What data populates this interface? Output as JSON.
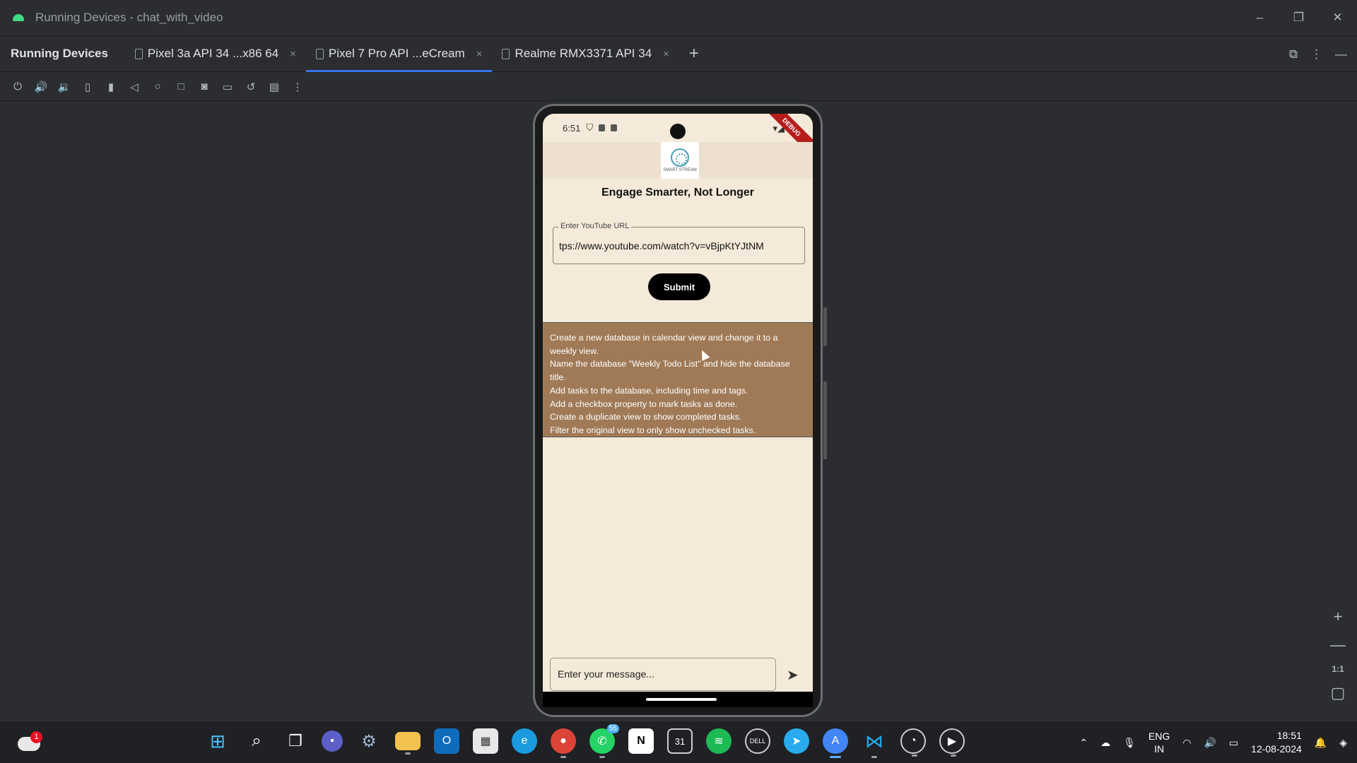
{
  "window": {
    "title": "Running Devices - chat_with_video",
    "minimize": "–",
    "restore": "❐",
    "close": "✕"
  },
  "tool_window": {
    "title": "Running Devices",
    "tabs": [
      {
        "label": "Pixel 3a API 34 ...x86 64",
        "close": "×"
      },
      {
        "label": "Pixel 7 Pro API ...eCream",
        "close": "×",
        "active": true
      },
      {
        "label": "Realme RMX3371 API 34",
        "close": "×"
      }
    ],
    "add_tab": "+"
  },
  "toolbar_icons": [
    "power-icon",
    "volume-up-icon",
    "volume-down-icon",
    "rotate-left-icon",
    "rotate-right-icon",
    "back-icon",
    "home-icon",
    "overview-icon",
    "screenshot-icon",
    "screen-record-icon",
    "reset-icon",
    "display-mode-icon",
    "more-icon"
  ],
  "device": {
    "status_time": "6:51",
    "debug_label": "DEBUG",
    "logo_text": "SMART STREAM",
    "headline": "Engage Smarter, Not Longer",
    "url_label": "Enter YouTube URL",
    "url_value": "tps://www.youtube.com/watch?v=vBjpKtYJtNM",
    "submit_label": "Submit",
    "summary_lines": [
      "Create a new database in calendar view and change it to a weekly view.",
      "Name the database \"Weekly Todo List\" and hide the database title.",
      "Add tasks to the database, including time and tags.",
      "Add a checkbox property to mark tasks as done.",
      "Create a duplicate view to show completed tasks.",
      "Filter the original view to only show unchecked tasks."
    ],
    "message_placeholder": "Enter your message..."
  },
  "zoom": {
    "plus": "+",
    "minus": "—",
    "actual": "1:1"
  },
  "taskbar": {
    "weather_badge": "1",
    "whatsapp_count": "55",
    "lang_top": "ENG",
    "lang_bottom": "IN",
    "time": "18:51",
    "date": "12-08-2024"
  },
  "colors": {
    "accent": "#3574f0",
    "summary_bg": "#a07a57",
    "app_bg": "#f5ead9"
  }
}
